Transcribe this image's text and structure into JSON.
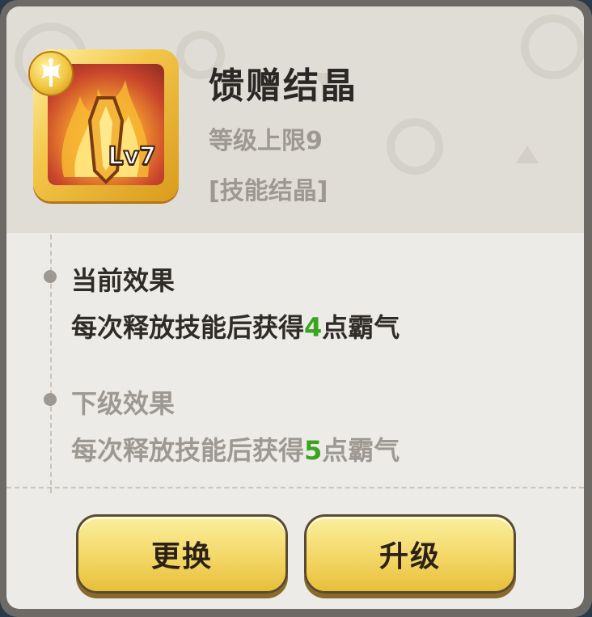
{
  "item": {
    "name": "馈赠结晶",
    "level_cap": "等级上限9",
    "type_label": "[技能结晶]",
    "level_badge": "Lv7",
    "icon": "flame-crystal-icon",
    "badge_icon": "axe-icon"
  },
  "current_effect": {
    "title": "当前效果",
    "desc_before": "每次释放技能后获得",
    "value": "4",
    "desc_after": "点霸气"
  },
  "next_effect": {
    "title": "下级效果",
    "desc_before": "每次释放技能后获得",
    "value": "5",
    "desc_after": "点霸气"
  },
  "buttons": {
    "swap_label": "更换",
    "upgrade_label": "升级"
  },
  "colors": {
    "highlight_number": "#38a51c",
    "button_gold": "#f3d766"
  }
}
